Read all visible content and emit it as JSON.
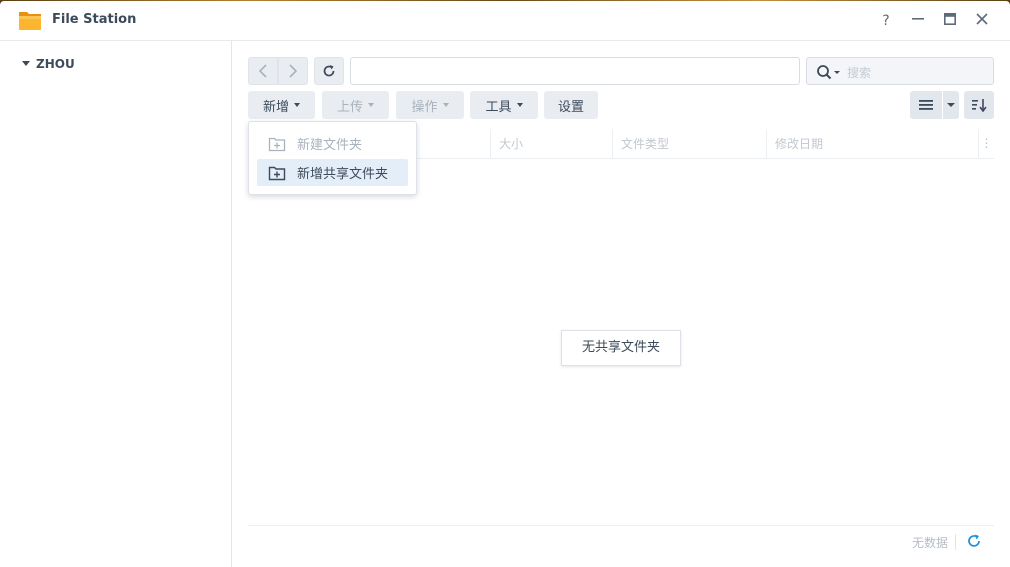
{
  "window": {
    "title": "File Station",
    "help_label": "?",
    "colors": {
      "accent": "#0086e5",
      "text": "#3c4a5a",
      "folder": "#f7a21b"
    }
  },
  "sidebar": {
    "root_label": "ZHOU"
  },
  "toolbar": {
    "new_label": "新增",
    "upload_label": "上传",
    "action_label": "操作",
    "tools_label": "工具",
    "settings_label": "设置",
    "path_value": "",
    "search_placeholder": "搜索"
  },
  "new_menu": {
    "items": [
      {
        "label": "新建文件夹",
        "enabled": false
      },
      {
        "label": "新增共享文件夹",
        "enabled": true
      }
    ]
  },
  "grid": {
    "columns": [
      "大小",
      "文件类型",
      "修改日期"
    ],
    "empty_message": "无共享文件夹"
  },
  "status": {
    "text": "无数据"
  }
}
